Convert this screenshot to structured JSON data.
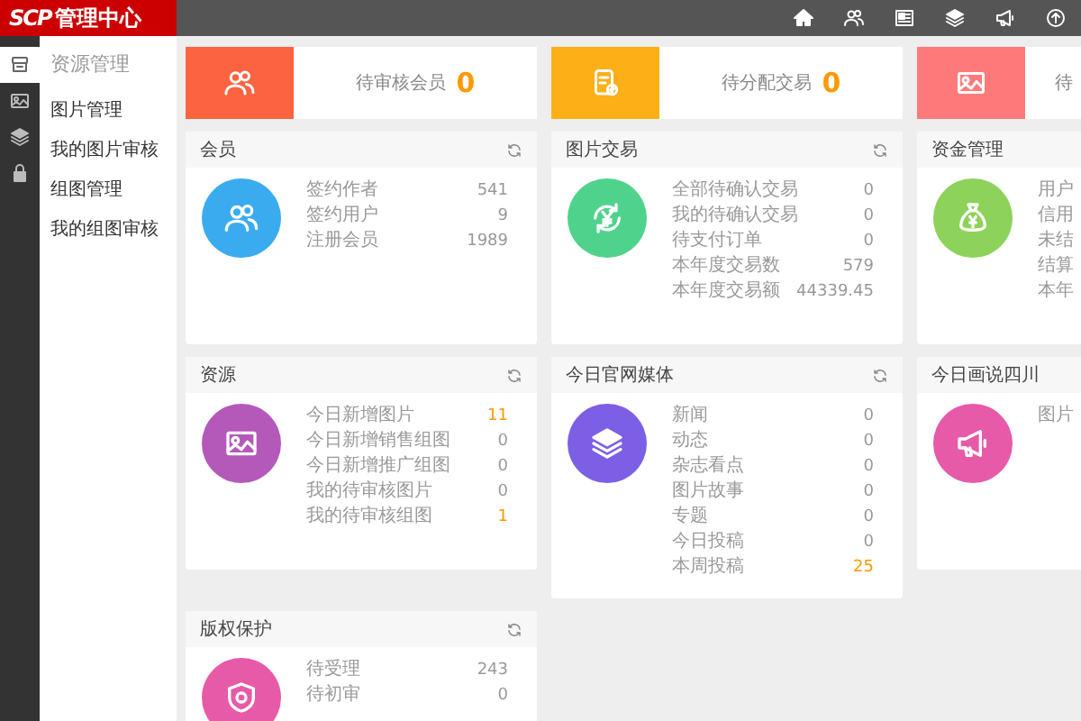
{
  "logo": {
    "brand": "SCP",
    "title": "管理中心"
  },
  "sidebar": {
    "items": [
      {
        "kind": "archive",
        "selected": true
      },
      {
        "kind": "image",
        "selected": false
      },
      {
        "kind": "layers",
        "selected": false
      },
      {
        "kind": "lock",
        "selected": false
      }
    ]
  },
  "submenu": {
    "title": "资源管理",
    "items": [
      "图片管理",
      "我的图片审核",
      "组图管理",
      "我的组图审核"
    ]
  },
  "stats": [
    {
      "kind": "users",
      "color": "#fc6340",
      "label": "待审核会员",
      "value": "0"
    },
    {
      "kind": "doc-check",
      "color": "#fdaf17",
      "label": "待分配交易",
      "value": "0"
    },
    {
      "kind": "image",
      "color": "#fe7a7a",
      "label": "待"
    }
  ],
  "panels": [
    {
      "title": "会员",
      "kind": "users",
      "color": "#3aabef",
      "refresh": true,
      "rows": [
        {
          "label": "签约作者",
          "value": "541",
          "highlight": false
        },
        {
          "label": "签约用户",
          "value": "9",
          "highlight": false
        },
        {
          "label": "注册会员",
          "value": "1989",
          "highlight": false
        }
      ]
    },
    {
      "title": "图片交易",
      "kind": "yuan-cycle",
      "color": "#4fd38c",
      "refresh": true,
      "rows": [
        {
          "label": "全部待确认交易",
          "value": "0",
          "highlight": false
        },
        {
          "label": "我的待确认交易",
          "value": "0",
          "highlight": false
        },
        {
          "label": "待支付订单",
          "value": "0",
          "highlight": false
        },
        {
          "label": "本年度交易数",
          "value": "579",
          "highlight": false
        },
        {
          "label": "本年度交易额",
          "value": "44339.45",
          "highlight": false
        }
      ]
    },
    {
      "title": "资金管理",
      "kind": "money-bag",
      "color": "#8dd25a",
      "refresh": false,
      "rows": [
        {
          "label": "用户"
        },
        {
          "label": "信用"
        },
        {
          "label": "未结"
        },
        {
          "label": "结算"
        },
        {
          "label": "本年"
        }
      ]
    },
    {
      "title": "资源",
      "kind": "image",
      "color": "#b459b9",
      "refresh": true,
      "rows": [
        {
          "label": "今日新增图片",
          "value": "11",
          "highlight": true
        },
        {
          "label": "今日新增销售组图",
          "value": "0",
          "highlight": false
        },
        {
          "label": "今日新增推广组图",
          "value": "0",
          "highlight": false
        },
        {
          "label": "我的待审核图片",
          "value": "0",
          "highlight": false
        },
        {
          "label": "我的待审核组图",
          "value": "1",
          "highlight": true
        }
      ]
    },
    {
      "title": "今日官网媒体",
      "kind": "layers",
      "color": "#7c5fe5",
      "refresh": true,
      "rows": [
        {
          "label": "新闻",
          "value": "0",
          "highlight": false
        },
        {
          "label": "动态",
          "value": "0",
          "highlight": false
        },
        {
          "label": "杂志看点",
          "value": "0",
          "highlight": false
        },
        {
          "label": "图片故事",
          "value": "0",
          "highlight": false
        },
        {
          "label": "专题",
          "value": "0",
          "highlight": false
        },
        {
          "label": "今日投稿",
          "value": "0",
          "highlight": false
        },
        {
          "label": "本周投稿",
          "value": "25",
          "highlight": true
        }
      ]
    },
    {
      "title": "今日画说四川",
      "kind": "megaphone",
      "color": "#e75aa8",
      "refresh": false,
      "rows": [
        {
          "label": "图片"
        }
      ]
    },
    {
      "title": "版权保护",
      "kind": "shield",
      "color": "#e75aa8",
      "refresh": true,
      "rows": [
        {
          "label": "待受理",
          "value": "243",
          "highlight": false
        },
        {
          "label": "待初审",
          "value": "0",
          "highlight": false
        }
      ]
    }
  ]
}
